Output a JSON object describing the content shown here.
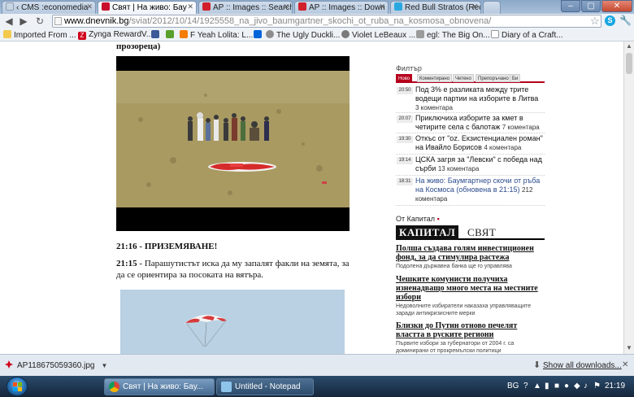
{
  "browser": {
    "tabs": [
      {
        "title": "‹ CMS :economedia",
        "active": false
      },
      {
        "title": "Свят | На живо: Бау",
        "active": true
      },
      {
        "title": "AP :: Images :: Search",
        "active": false
      },
      {
        "title": "AP :: Images :: Down",
        "active": false
      },
      {
        "title": "Red Bull Stratos (Rec",
        "active": false
      }
    ],
    "url_host": "www.dnevnik.bg",
    "url_path": "/sviat/2012/10/14/1925558_na_jivo_baumgartner_skochi_ot_ruba_na_kosmosa_obnovena/",
    "bookmarks": [
      "Imported From ...",
      "Zynga RewardV...",
      "",
      "",
      "F Yeah Lolita: L...",
      "",
      "The Ugly Duckli...",
      "Violet LeBeaux ...",
      "egl: The Big On...",
      "Diary of a Craft..."
    ]
  },
  "article": {
    "head_fragment": "прозореца)",
    "timestamp_heading": "21:16 - ПРИЗЕМЯВАНЕ!",
    "para_time": "21:15",
    "para_text": " - Парашутистът иска да му запалят факли на земята, за да се ориентира за посоката на вятъра."
  },
  "sidebar": {
    "filter_title": "Филтър",
    "filter_tabs": [
      "Ново",
      "Коментирано",
      "Четено",
      "Препоръчано",
      "Би"
    ],
    "news": [
      {
        "time": "20:50",
        "text": "Под 3% е разликата между трите водещи партии на изборите в Литва",
        "count": "3 коментара"
      },
      {
        "time": "20:07",
        "text": "Приключиха изборите за кмет в четирите села с балотаж",
        "count": "7 коментара"
      },
      {
        "time": "19:30",
        "text": "Откъс от \"oz. Екзистенциален роман\" на Ивайло Борисов",
        "count": "4 коментара"
      },
      {
        "time": "19:14",
        "text": "ЦСКА загря за \"Левски\" с победа над сърби",
        "count": "13 коментара"
      },
      {
        "time": "18:31",
        "text": "На живо: Баумгартнер скочи от ръба на Космоса (обновена в 21:15)",
        "count": "212 коментара"
      }
    ],
    "ot_kapital": "От Капитал",
    "kapital_logo": "КАПИТАЛ",
    "kapital_section": "СВЯТ",
    "kapital_items": [
      {
        "headline": "Полша създава голям инвестиционен фонд, за да стимулира растежа",
        "sub": "Подолена държавна банка ще го управлява"
      },
      {
        "headline": "Чешките комунисти получиха изненадващо много места на местните избори",
        "sub": "Недоволните избиратели наказаха управляващите заради антикризисните мерки"
      },
      {
        "headline": "Близки до Путин отново печелят властта в руските региони",
        "sub": "Първите избори за губернатори от 2004 г. са доминирани от прокремълски политици"
      }
    ]
  },
  "downloads": {
    "file": "AP118675059360.jpg",
    "show_all": "Show all downloads..."
  },
  "taskbar": {
    "buttons": [
      "Свят | На живо: Бау...",
      "Untitled - Notepad"
    ],
    "lang": "BG",
    "clock": "21:19"
  },
  "colors": {
    "accent": "#b5001c",
    "link": "#2a4b8d"
  }
}
